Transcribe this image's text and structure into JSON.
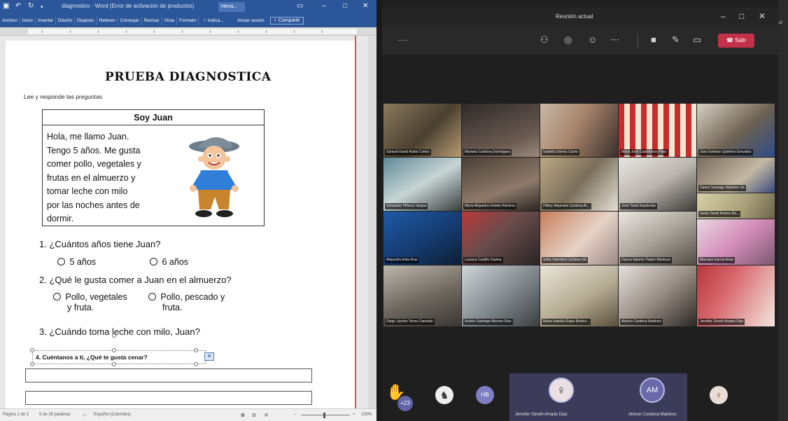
{
  "word": {
    "window_title": "diagnostico - Word (Error de activación de productos)",
    "title_chip": "Herra...",
    "ribbon_tabs": [
      "Archivo",
      "Inicio",
      "Insertar",
      "Diseño",
      "Disposic",
      "Referen",
      "Correspo",
      "Revisar",
      "Vista",
      "Formato"
    ],
    "tell_me": "♀ Indica...",
    "sign_in": "Iniciar sesión",
    "share": "Compartir",
    "doc": {
      "title": "PRUEBA DIAGNOSTICA",
      "instructions": "Lee y responde las preguntas",
      "story_title": "Soy Juan",
      "story_lines": [
        "Hola, me llamo Juan.",
        "Tengo 5 años. Me gusta",
        "comer pollo, vegetales y",
        "frutas en el almuerzo y",
        "tomar leche con milo",
        "por las noches antes de",
        "dormir."
      ],
      "q1": "1. ¿Cuántos años tiene Juan?",
      "q1_opt1": "5 años",
      "q1_opt2": "6 años",
      "q2": "2. ¿Qué le gusta comer a Juan en el almuerzo?",
      "q2_opt1_l1": "Pollo, vegetales",
      "q2_opt1_l2": "y fruta.",
      "q2_opt2_l1": "Pollo, pescado y",
      "q2_opt2_l2": "fruta.",
      "q3": "3. ¿Cuándo toma leche con milo, Juan?",
      "q4": "4. Cuéntanos a ti, ¿Qué te gusta cenar?"
    },
    "status": {
      "page": "Página 1 de 2",
      "words": "5 de 26 palabras",
      "language": "Español (Colombia)",
      "zoom": "100%"
    }
  },
  "teams": {
    "title": "Reunión actual",
    "leave_label": "Salir",
    "participants": [
      "Samuel David Rubio Cortes",
      "Mariana Cardona Dominguez",
      "Isabella Gómez Carrio",
      "Maria José Castellanos Paez",
      "Juan Esteban Quintero Gonzalez",
      "",
      "",
      "",
      "",
      "Daniel Santiago Martínez Gil",
      "Sebastián Piñeros Vargas",
      "Maria Alejandra Oviedo Ramírez",
      "Hillary Alejandra Cardona Ar...",
      "José Yesid Sepúlveda",
      "Jesús David Ramos Ro...",
      "Alejandro Avila Ruiz",
      "Luciana Castillo Ospina",
      "Sofía Valentina Cardona Gil",
      "Danna Salome Pabón Montoya",
      "Manuela García Arias",
      "Diego Jacobo Torres Zamudio",
      "Andrés Santiago Moreno Ruiz",
      "Maria Isabella Rojas Betanc...",
      "Alisson Cardona Martinez",
      "Jennifer Gineth Amado Diaz"
    ],
    "more_count": "+23",
    "pill_initials": "HB",
    "highlight_1_name": "Jennifer Gineth Amado Diaz",
    "highlight_2_initials": "AM",
    "highlight_2_name": "Alisson Cardona Martinez"
  }
}
